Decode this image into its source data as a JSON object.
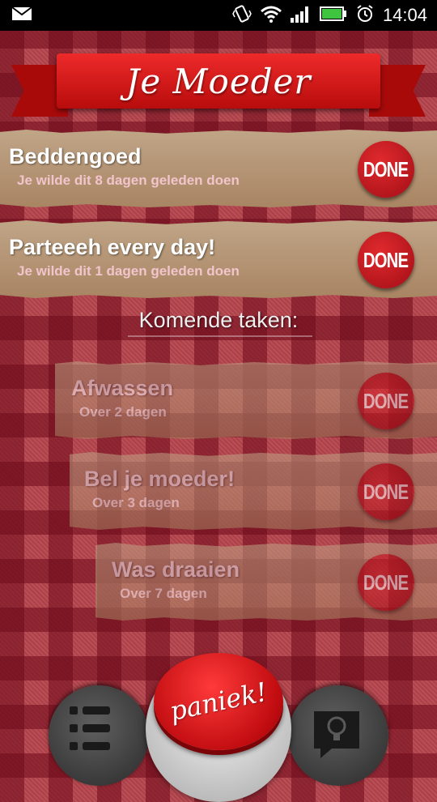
{
  "status_bar": {
    "time": "14:04",
    "icons": [
      "mail-icon",
      "vibrate-icon",
      "wifi-icon",
      "signal-icon",
      "battery-icon",
      "alarm-icon"
    ]
  },
  "header": {
    "title": "Je Moeder"
  },
  "due_tasks": [
    {
      "title": "Beddengoed",
      "subtitle": "Je wilde dit 8 dagen geleden doen",
      "button": "DONE"
    },
    {
      "title": "Parteeeh every day!",
      "subtitle": "Je wilde dit 1 dagen geleden doen",
      "button": "DONE"
    }
  ],
  "upcoming": {
    "heading": "Komende taken:",
    "tasks": [
      {
        "title": "Afwassen",
        "subtitle": "Over 2 dagen",
        "button": "DONE"
      },
      {
        "title": "Bel je moeder!",
        "subtitle": "Over 3 dagen",
        "button": "DONE"
      },
      {
        "title": "Was draaien",
        "subtitle": "Over 7 dagen",
        "button": "DONE"
      }
    ]
  },
  "bottom_bar": {
    "panic_label": "paniek!",
    "left_icon": "list-icon",
    "right_icon": "lightbulb-speech-icon"
  },
  "colors": {
    "accent_red": "#c4121a",
    "paper": "#b39473",
    "subtitle_pink": "#f2c4cc"
  }
}
